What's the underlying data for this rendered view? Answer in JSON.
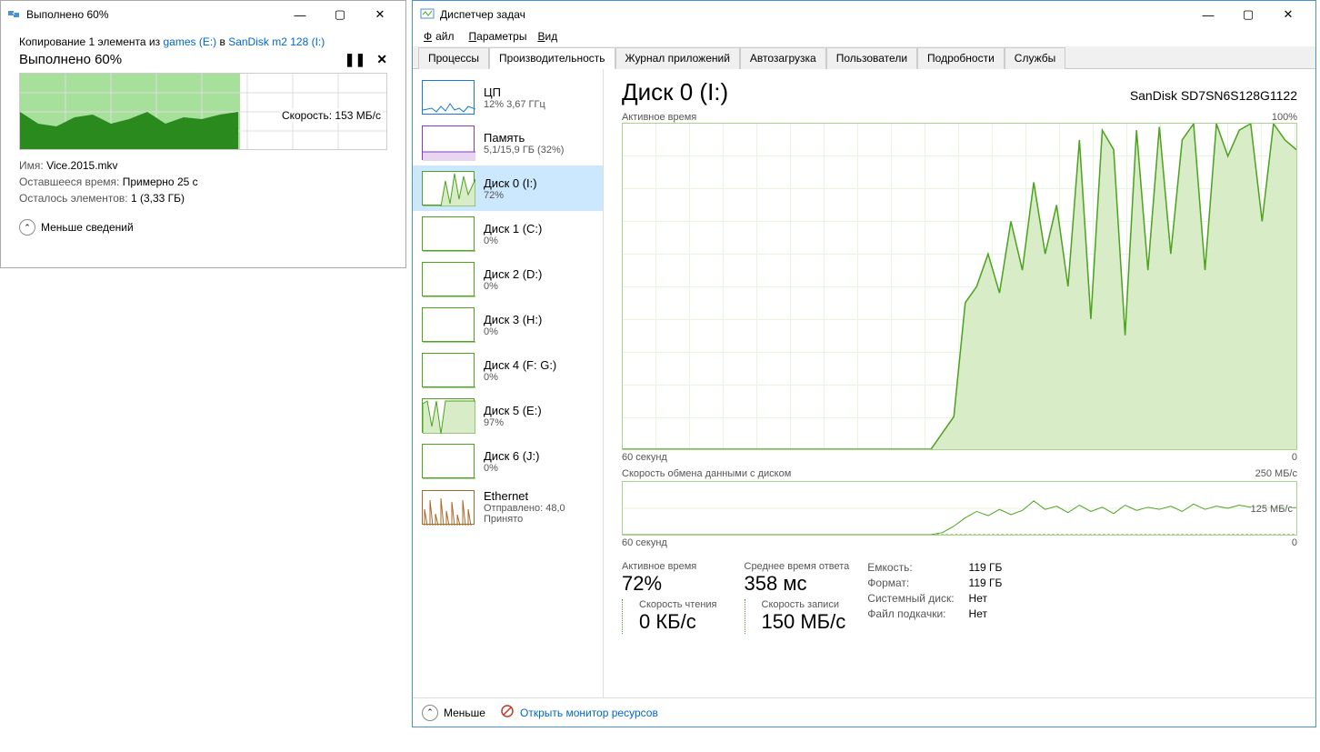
{
  "copy": {
    "title": "Выполнено 60%",
    "desc_prefix": "Копирование 1 элемента из ",
    "desc_src": "games (E:)",
    "desc_mid": " в ",
    "desc_dst": "SanDisk m2 128 (I:)",
    "progress_title": "Выполнено 60%",
    "speed_label": "Скорость: 153 МБ/с",
    "name_label": "Имя:",
    "name_value": "Vice.2015.mkv",
    "remain_label": "Оставшееся время:",
    "remain_value": "Примерно 25 с",
    "items_label": "Осталось элементов:",
    "items_value": "1 (3,33 ГБ)",
    "less": "Меньше сведений"
  },
  "tm": {
    "title": "Диспетчер задач",
    "menu": {
      "file": "Файл",
      "options": "Параметры",
      "view": "Вид"
    },
    "tabs": [
      "Процессы",
      "Производительность",
      "Журнал приложений",
      "Автозагрузка",
      "Пользователи",
      "Подробности",
      "Службы"
    ],
    "active_tab": 1,
    "sidebar": [
      {
        "title": "ЦП",
        "sub": "12% 3,67 ГГц",
        "type": "cpu"
      },
      {
        "title": "Память",
        "sub": "5,1/15,9 ГБ (32%)",
        "type": "mem"
      },
      {
        "title": "Диск 0 (I:)",
        "sub": "72%",
        "type": "disk",
        "selected": true
      },
      {
        "title": "Диск 1 (C:)",
        "sub": "0%",
        "type": "disk"
      },
      {
        "title": "Диск 2 (D:)",
        "sub": "0%",
        "type": "disk"
      },
      {
        "title": "Диск 3 (H:)",
        "sub": "0%",
        "type": "disk"
      },
      {
        "title": "Диск 4 (F: G:)",
        "sub": "0%",
        "type": "disk"
      },
      {
        "title": "Диск 5 (E:)",
        "sub": "97%",
        "type": "disk"
      },
      {
        "title": "Диск 6 (J:)",
        "sub": "0%",
        "type": "disk"
      },
      {
        "title": "Ethernet",
        "sub": "Отправлено: 48,0 Принято",
        "type": "eth"
      }
    ],
    "main": {
      "title": "Диск 0 (I:)",
      "model": "SanDisk SD7SN6S128G1122",
      "chart1_label": "Активное время",
      "chart1_max": "100%",
      "chart1_ymin": "0",
      "xaxis_left": "60 секунд",
      "chart2_label": "Скорость обмена данными с диском",
      "chart2_max": "250 МБ/с",
      "chart2_mid": "125 МБ/с",
      "chart2_ymin": "0",
      "stats": {
        "active_time_l": "Активное время",
        "active_time_v": "72%",
        "avg_resp_l": "Среднее время ответа",
        "avg_resp_v": "358 мс",
        "read_l": "Скорость чтения",
        "read_v": "0 КБ/с",
        "write_l": "Скорость записи",
        "write_v": "150 МБ/с"
      },
      "props": {
        "capacity_l": "Емкость:",
        "capacity_v": "119 ГБ",
        "formatted_l": "Формат:",
        "formatted_v": "119 ГБ",
        "sysdisk_l": "Системный диск:",
        "sysdisk_v": "Нет",
        "pagefile_l": "Файл подкачки:",
        "pagefile_v": "Нет"
      }
    },
    "footer": {
      "less": "Меньше",
      "resmon": "Открыть монитор ресурсов"
    }
  },
  "chart_data": [
    {
      "type": "area",
      "title": "Активное время",
      "ylabel": "%",
      "ylim": [
        0,
        100
      ],
      "xlabel": "секунды",
      "xlim": [
        60,
        0
      ],
      "values": [
        0,
        0,
        0,
        0,
        0,
        0,
        0,
        0,
        0,
        0,
        0,
        0,
        0,
        0,
        0,
        0,
        0,
        0,
        0,
        0,
        0,
        0,
        0,
        0,
        0,
        0,
        0,
        0,
        5,
        10,
        45,
        50,
        60,
        48,
        70,
        55,
        82,
        60,
        75,
        50,
        95,
        40,
        98,
        92,
        35,
        98,
        55,
        99,
        60,
        95,
        100,
        55,
        100,
        90,
        98,
        100,
        70,
        100,
        95,
        92
      ]
    },
    {
      "type": "line",
      "title": "Скорость обмена данными с диском",
      "ylabel": "МБ/с",
      "ylim": [
        0,
        250
      ],
      "xlabel": "секунды",
      "xlim": [
        60,
        0
      ],
      "series": [
        {
          "name": "Запись",
          "values": [
            0,
            0,
            0,
            0,
            0,
            0,
            0,
            0,
            0,
            0,
            0,
            0,
            0,
            0,
            0,
            0,
            0,
            0,
            0,
            0,
            0,
            0,
            0,
            0,
            0,
            0,
            0,
            0,
            10,
            40,
            80,
            110,
            90,
            120,
            95,
            115,
            160,
            120,
            135,
            105,
            140,
            110,
            130,
            100,
            140,
            115,
            130,
            120,
            135,
            110,
            145,
            120,
            135,
            125,
            140,
            130,
            135,
            125,
            130,
            128
          ]
        },
        {
          "name": "Чтение",
          "values": [
            0,
            0,
            0,
            0,
            0,
            0,
            0,
            0,
            0,
            0,
            0,
            0,
            0,
            0,
            0,
            0,
            0,
            0,
            0,
            0,
            0,
            0,
            0,
            0,
            0,
            0,
            0,
            0,
            0,
            0,
            0,
            0,
            0,
            0,
            0,
            0,
            0,
            0,
            0,
            0,
            0,
            0,
            0,
            0,
            0,
            0,
            0,
            0,
            0,
            0,
            0,
            0,
            0,
            0,
            0,
            0,
            0,
            0,
            0,
            0
          ]
        }
      ]
    }
  ]
}
